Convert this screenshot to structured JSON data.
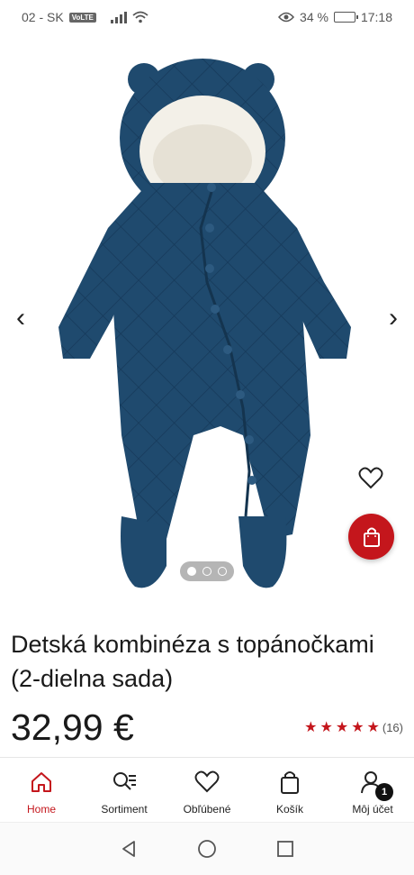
{
  "status_bar": {
    "carrier": "02 - SK",
    "volte": "VoLTE",
    "battery_text": "34 %",
    "battery_level": 0.34,
    "time": "17:18"
  },
  "gallery": {
    "image_count": 3,
    "active_index": 0
  },
  "product": {
    "title": "Detská kombinéza s topánočkami (2-dielna sada)",
    "price": "32,99 €",
    "rating_stars": 5,
    "rating_count": "(16)"
  },
  "bottom_nav": {
    "items": [
      {
        "label": "Home"
      },
      {
        "label": "Sortiment"
      },
      {
        "label": "Obľúbené"
      },
      {
        "label": "Košík"
      },
      {
        "label": "Môj účet"
      }
    ],
    "cart_badge": "1",
    "accent_color": "#c4161c"
  }
}
